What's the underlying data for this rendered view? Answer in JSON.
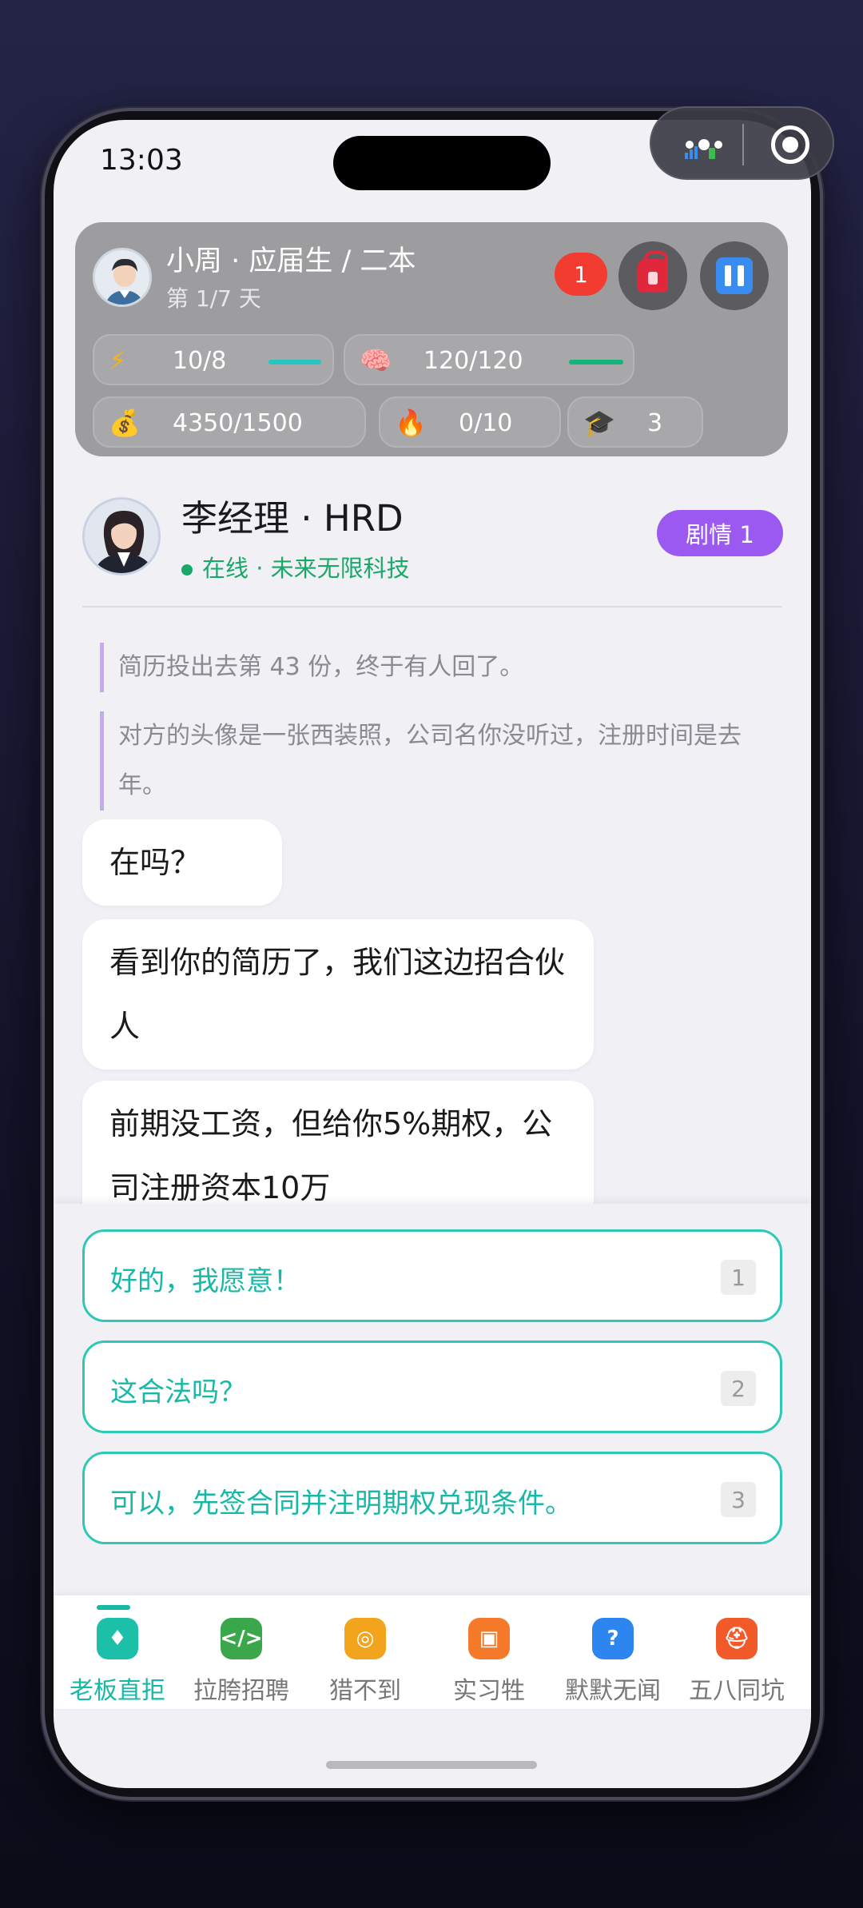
{
  "status_bar": {
    "time": "13:03"
  },
  "hud": {
    "player_name": "小周 · 应届生 / 二本",
    "day": "第 1/7 天",
    "notification_count": "1",
    "stats": {
      "energy": {
        "value": "10/8",
        "icon": "lightning-icon",
        "color": "#21c7c0",
        "fill": 1.0
      },
      "mind": {
        "value": "120/120",
        "icon": "brain-icon",
        "color": "#13b47a",
        "fill": 1.0
      },
      "money": {
        "value": "4350/1500",
        "icon": "money-bag-icon"
      },
      "fire": {
        "value": "0/10",
        "icon": "fire-icon"
      },
      "degree": {
        "value": "3",
        "icon": "graduation-cap-icon"
      }
    }
  },
  "npc": {
    "name": "李经理 · HRD",
    "status": "在线 · 未来无限科技",
    "plot_badge": "剧情 1"
  },
  "narration": [
    "简历投出去第 43 份，终于有人回了。",
    "对方的头像是一张西装照，公司名你没听过，注册时间是去年。"
  ],
  "messages": [
    "在吗？",
    "看到你的简历了，我们这边招合伙人",
    "前期没工资，但给你5%期权，公司注册资本10万"
  ],
  "choices": [
    {
      "text": "好的，我愿意！",
      "key": "1"
    },
    {
      "text": "这合法吗？",
      "key": "2"
    },
    {
      "text": "可以，先签合同并注明期权兑现条件。",
      "key": "3"
    }
  ],
  "tabs": [
    {
      "label": "老板直拒",
      "icon": "tie-icon",
      "color": "#1cbfa8",
      "glyph": "♦"
    },
    {
      "label": "拉胯招聘",
      "icon": "code-icon",
      "color": "#3aa84a",
      "glyph": "</>"
    },
    {
      "label": "猎不到",
      "icon": "target-icon",
      "color": "#f2a41c",
      "glyph": "◎"
    },
    {
      "label": "实习牲",
      "icon": "box-icon",
      "color": "#f47a2a",
      "glyph": "▣"
    },
    {
      "label": "默默无闻",
      "icon": "question-icon",
      "color": "#2d86f0",
      "glyph": "?"
    },
    {
      "label": "五八同坑",
      "icon": "helmet-icon",
      "color": "#f25a2a",
      "glyph": "⛑"
    }
  ]
}
